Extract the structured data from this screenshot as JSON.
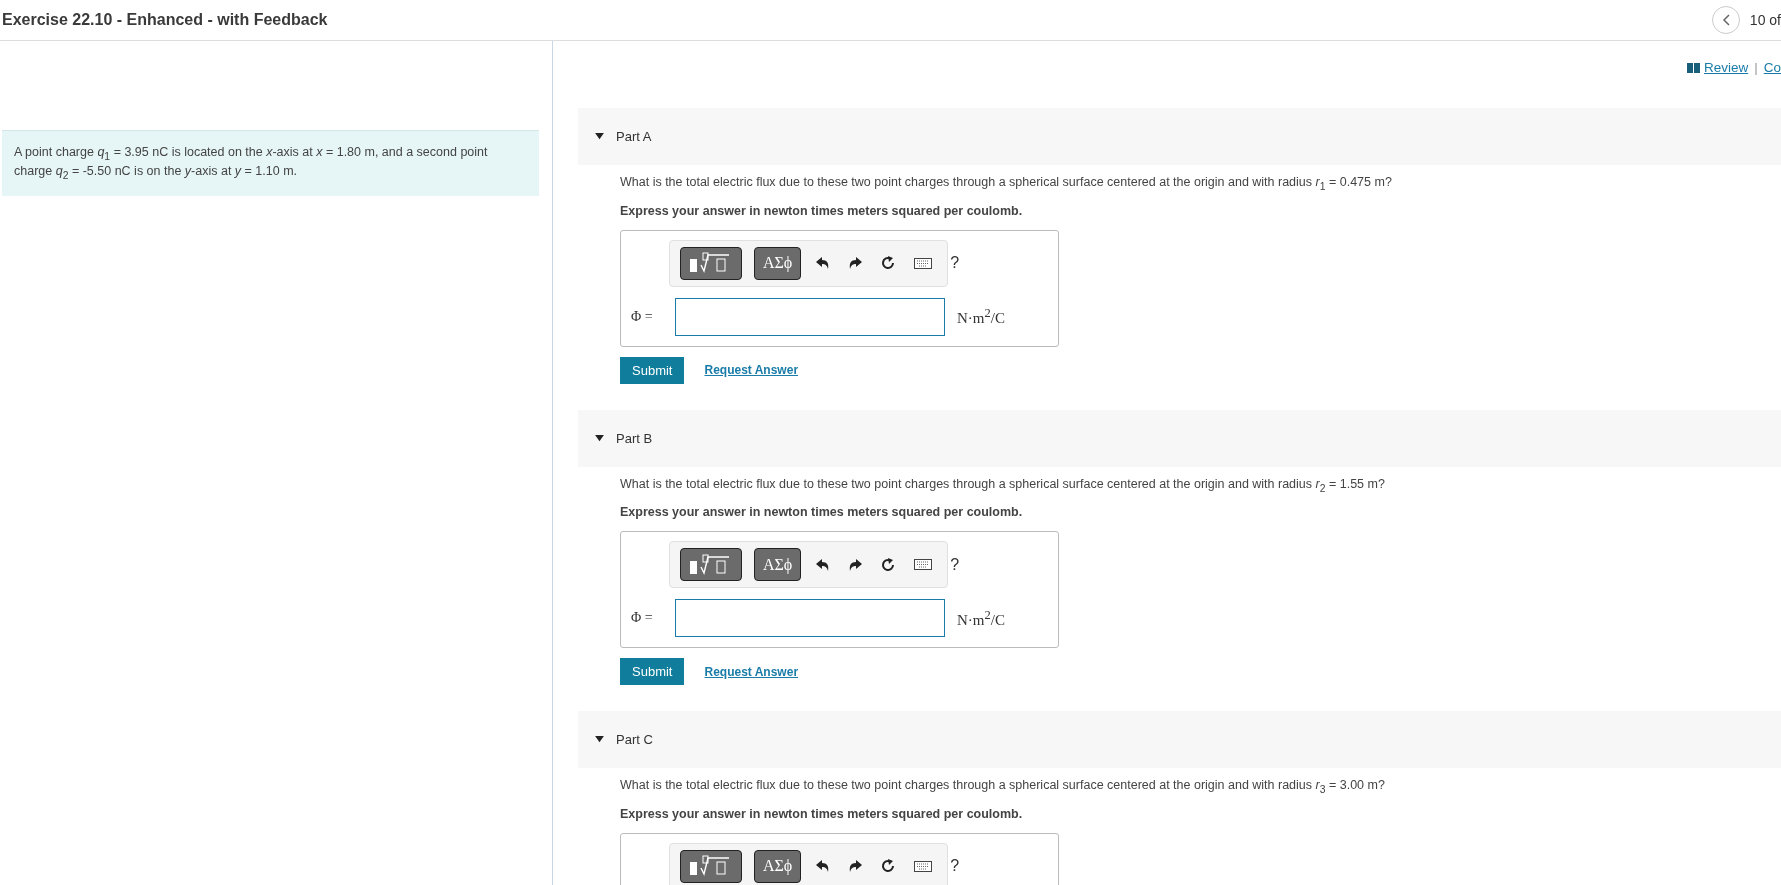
{
  "header": {
    "title": "Exercise 22.10 - Enhanced - with Feedback",
    "position": "10 of"
  },
  "links": {
    "review": "Review",
    "separator": "|",
    "next": "Co"
  },
  "problem": "A point charge *q*$_{1}$ = 3.95 nC is located on the *x*-axis at *x* = 1.80 m, and a second point charge *q*$_{2}$ = -5.50 nC is on the *y*-axis at *y* = 1.10 m.",
  "parts": [
    {
      "label": "Part A",
      "expanded": true,
      "question": "What is the total electric flux due to these two point charges through a spherical surface centered at the origin and with radius *r*$_{1}$ = 0.475 m?",
      "instruction": "Express your answer in newton times meters squared per coulomb.",
      "toolbar": {
        "greek": "ΑΣϕ",
        "help": "?"
      },
      "symbol": "Φ =",
      "unit": "N·m$^{2}$/C",
      "submit": "Submit",
      "request": "Request Answer"
    },
    {
      "label": "Part B",
      "expanded": true,
      "question": "What is the total electric flux due to these two point charges through a spherical surface centered at the origin and with radius *r*$_{2}$ = 1.55 m?",
      "instruction": "Express your answer in newton times meters squared per coulomb.",
      "toolbar": {
        "greek": "ΑΣϕ",
        "help": "?"
      },
      "symbol": "Φ =",
      "unit": "N·m$^{2}$/C",
      "submit": "Submit",
      "request": "Request Answer"
    },
    {
      "label": "Part C",
      "expanded": true,
      "question": "What is the total electric flux due to these two point charges through a spherical surface centered at the origin and with radius *r*$_{3}$ = 3.00 m?",
      "instruction": "Express your answer in newton times meters squared per coulomb.",
      "toolbar": {
        "greek": "ΑΣϕ",
        "help": "?"
      }
    }
  ]
}
